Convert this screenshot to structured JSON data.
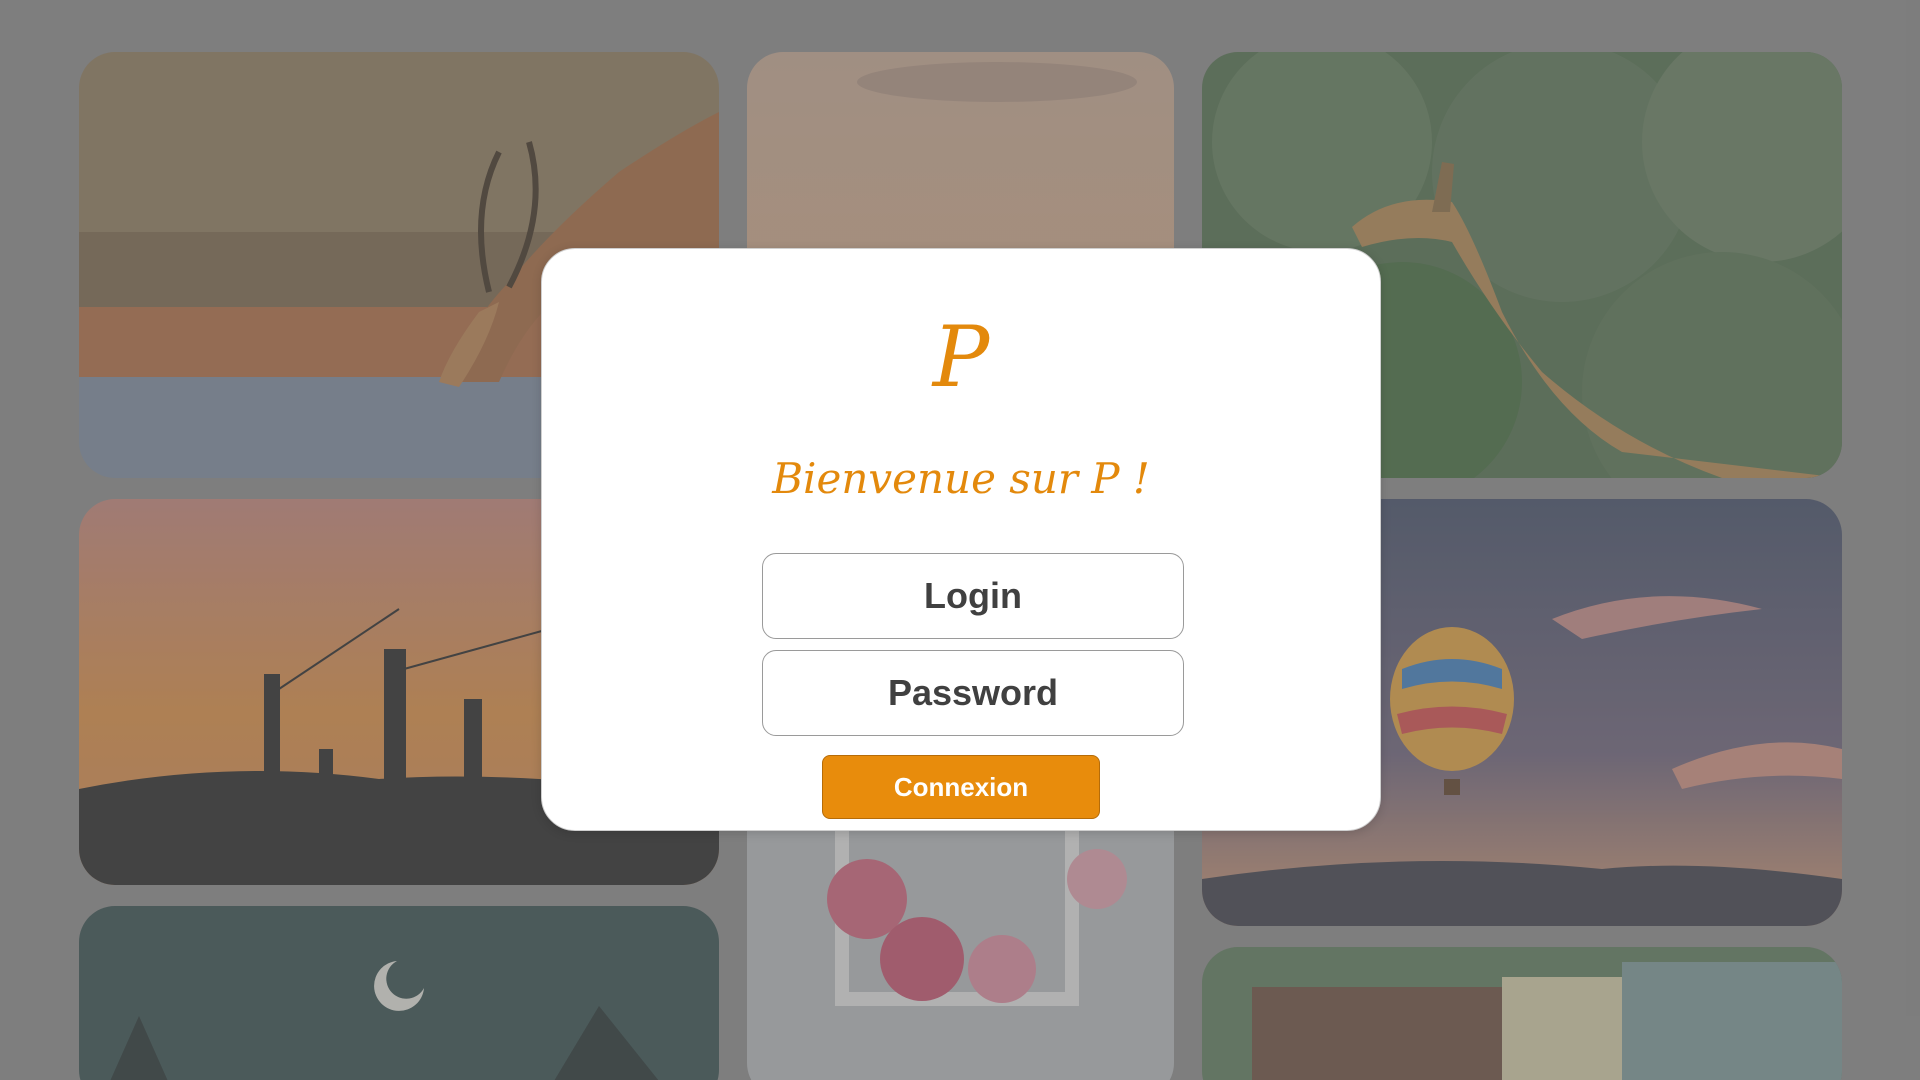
{
  "login_modal": {
    "logo_letter": "P",
    "welcome_text": "Bienvenue sur P !",
    "login_placeholder": "Login",
    "password_placeholder": "Password",
    "submit_label": "Connexion",
    "accent_color": "#e88c0c"
  },
  "background_gallery": {
    "images": [
      {
        "subject": "impala-drinking"
      },
      {
        "subject": "sunset-sky"
      },
      {
        "subject": "giraffe"
      },
      {
        "subject": "fishermen-silhouette"
      },
      {
        "subject": "flowers-frame"
      },
      {
        "subject": "hot-air-balloon"
      },
      {
        "subject": "moon-night-trees"
      },
      {
        "subject": "vintage-car-caravan"
      }
    ]
  }
}
